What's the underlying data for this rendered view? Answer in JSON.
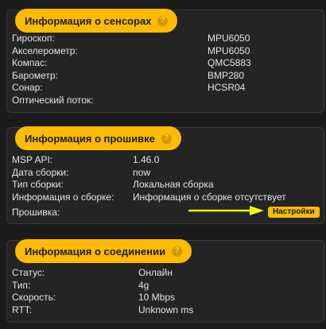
{
  "sensors": {
    "title": "Информация о сенсорах",
    "help": "?",
    "rows": [
      {
        "label": "Гироскоп:",
        "value": "MPU6050"
      },
      {
        "label": "Акселерометр:",
        "value": "MPU6050"
      },
      {
        "label": "Компас:",
        "value": "QMC5883"
      },
      {
        "label": "Барометр:",
        "value": "BMP280"
      },
      {
        "label": "Сонар:",
        "value": "HCSR04"
      },
      {
        "label": "Оптический поток:",
        "value": ""
      }
    ]
  },
  "firmware": {
    "title": "Информация о прошивке",
    "help": "?",
    "rows": [
      {
        "label": "MSP API:",
        "value": "1.46.0"
      },
      {
        "label": "Дата сборки:",
        "value": "now"
      },
      {
        "label": "Тип сборки:",
        "value": "Локальная сборка"
      },
      {
        "label": "Информация о сборке:",
        "value": "Информация о сборке отсутствует"
      },
      {
        "label": "Прошивка:",
        "value": ""
      }
    ],
    "settings_button": "Настройки",
    "arrow_color": "#f5f500"
  },
  "connection": {
    "title": "Информация о соединении",
    "help": "?",
    "rows": [
      {
        "label": "Статус:",
        "value": "Онлайн"
      },
      {
        "label": "Тип:",
        "value": "4g"
      },
      {
        "label": "Скорость:",
        "value": "10 Mbps"
      },
      {
        "label": "RTT:",
        "value": "Unknown ms"
      }
    ]
  },
  "colors": {
    "accent": "#ffbb00",
    "background": "#1b1b1b",
    "panel": "#242424",
    "text": "#e4e4e4"
  }
}
